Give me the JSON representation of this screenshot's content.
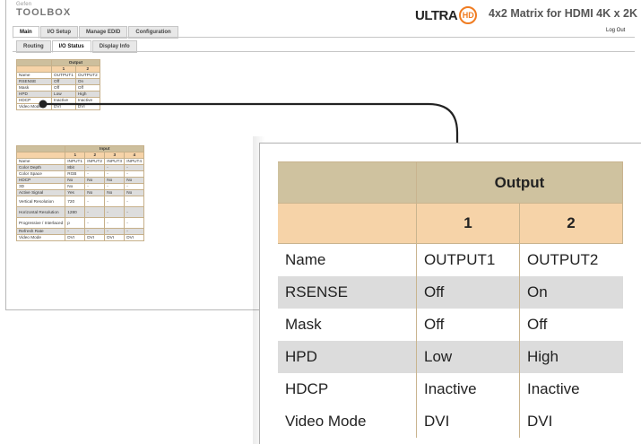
{
  "header": {
    "logo_brand": "Gefen",
    "logo_name": "TOOLBOX",
    "ultra_text": "ULTRA",
    "hd_badge": "HD",
    "product_title": "4x2 Matrix for HDMI 4K x 2K",
    "logout_label": "Log Out"
  },
  "main_tabs": [
    "Main",
    "I/O Setup",
    "Manage EDID",
    "Configuration"
  ],
  "sub_tabs": [
    "Routing",
    "I/O Status",
    "Display Info"
  ],
  "output_table": {
    "title": "Output",
    "columns": [
      "1",
      "2"
    ],
    "rows": [
      {
        "label": "Name",
        "values": [
          "OUTPUT1",
          "OUTPUT2"
        ]
      },
      {
        "label": "RSENSE",
        "values": [
          "Off",
          "On"
        ]
      },
      {
        "label": "Mask",
        "values": [
          "Off",
          "Off"
        ]
      },
      {
        "label": "HPD",
        "values": [
          "Low",
          "High"
        ]
      },
      {
        "label": "HDCP",
        "values": [
          "Inactive",
          "Inactive"
        ]
      },
      {
        "label": "Video Mode",
        "values": [
          "DVI",
          "DVI"
        ]
      }
    ]
  },
  "input_table": {
    "title": "Input",
    "columns": [
      "1",
      "2",
      "3",
      "4"
    ],
    "rows": [
      {
        "label": "Name",
        "values": [
          "INPUT1",
          "INPUT2",
          "INPUT3",
          "INPUT4"
        ]
      },
      {
        "label": "Color Depth",
        "values": [
          "8bit",
          "-",
          "-",
          "-"
        ]
      },
      {
        "label": "Color Space",
        "values": [
          "RGB",
          "-",
          "-",
          "-"
        ]
      },
      {
        "label": "HDCP",
        "values": [
          "No",
          "No",
          "No",
          "No"
        ]
      },
      {
        "label": "3D",
        "values": [
          "No",
          "-",
          "-",
          "-"
        ]
      },
      {
        "label": "Active Signal",
        "values": [
          "Yes",
          "No",
          "No",
          "No"
        ]
      },
      {
        "label": "Vertical Resolution",
        "values": [
          "720",
          "-",
          "-",
          "-"
        ]
      },
      {
        "label": "Horizontal Resolution",
        "values": [
          "1280",
          "-",
          "-",
          "-"
        ]
      },
      {
        "label": "Progressive / Interlaced",
        "values": [
          "p",
          "-",
          "-",
          "-"
        ]
      },
      {
        "label": "Refresh Rate",
        "values": [
          "-",
          "-",
          "-",
          "-"
        ]
      },
      {
        "label": "Video Mode",
        "values": [
          "DVI",
          "DVI",
          "DVI",
          "DVI"
        ]
      }
    ]
  },
  "colors": {
    "header_tan": "#cdbf9d",
    "number_peach": "#f6d3a8",
    "row_shade": "#dddddd",
    "hd_orange": "#f07c21"
  }
}
